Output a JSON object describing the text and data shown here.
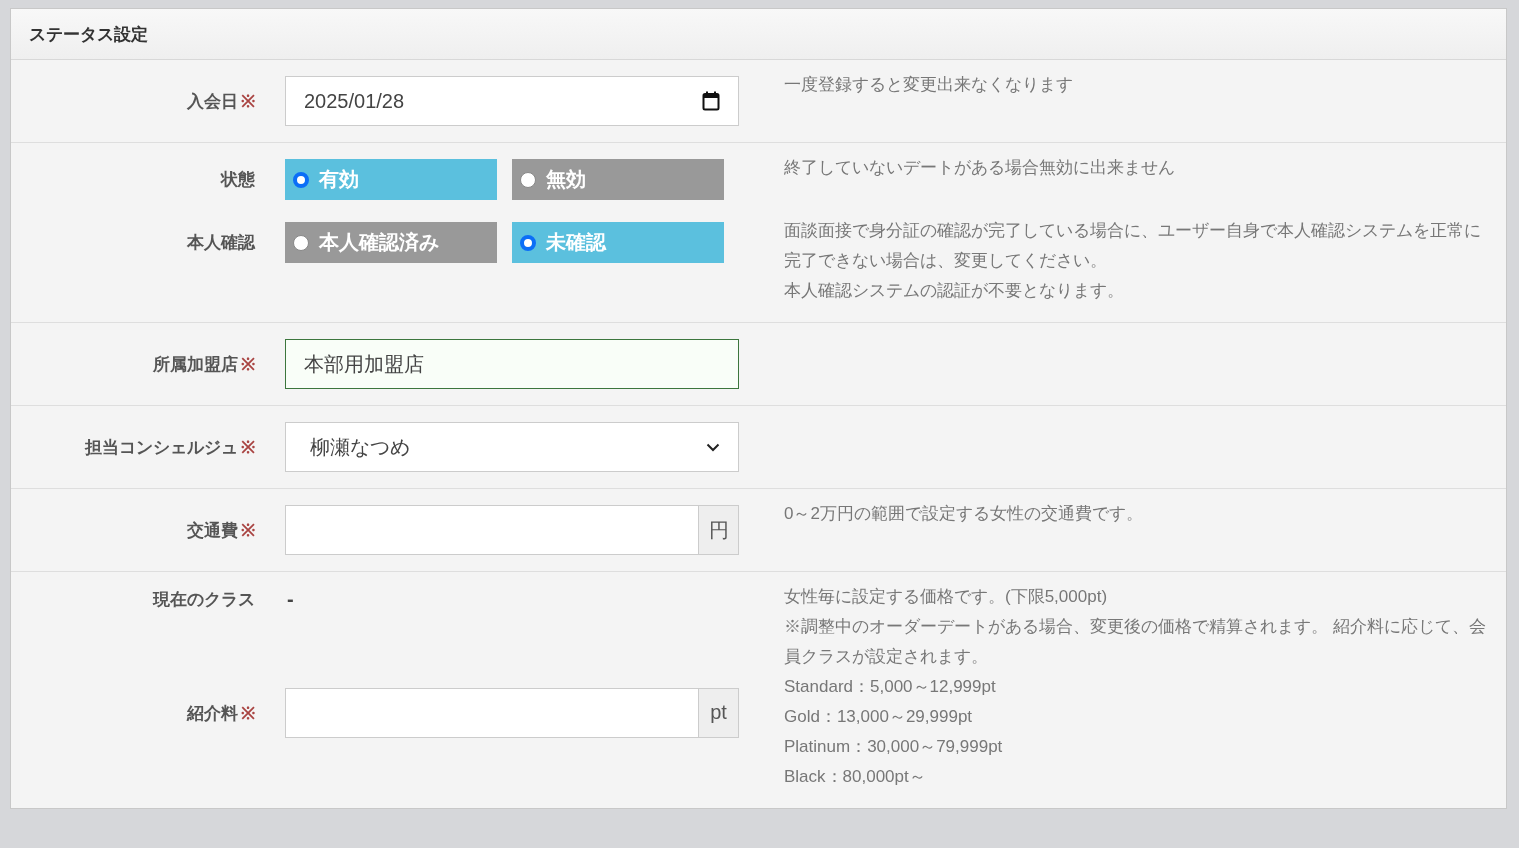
{
  "panel": {
    "title": "ステータス設定"
  },
  "sections": [
    {
      "fields": [
        {
          "kind": "date",
          "label": "入会日",
          "required_mark": "※",
          "value": "2025/01/28",
          "help": [
            "一度登録すると変更出来なくなります"
          ]
        }
      ]
    },
    {
      "fields": [
        {
          "kind": "radio",
          "label": "状態",
          "options": [
            {
              "label": "有効",
              "selected": true
            },
            {
              "label": "無効",
              "selected": false
            }
          ],
          "help": [
            "終了していないデートがある場合無効に出来ません"
          ]
        },
        {
          "kind": "radio",
          "label": "本人確認",
          "options": [
            {
              "label": "本人確認済み",
              "selected": false
            },
            {
              "label": "未確認",
              "selected": true
            }
          ],
          "help": [
            "面談面接で身分証の確認が完了している場合に、ユーザー自身で本人確認システムを正常に完了できない場合は、変更してください。",
            "本人確認システムの認証が不要となります。"
          ]
        }
      ]
    },
    {
      "fields": [
        {
          "kind": "text",
          "label": "所属加盟店",
          "required_mark": "※",
          "value": "本部用加盟店",
          "valid": true
        }
      ]
    },
    {
      "fields": [
        {
          "kind": "select",
          "label": "担当コンシェルジュ",
          "required_mark": "※",
          "value": "柳瀬なつめ"
        }
      ]
    },
    {
      "fields": [
        {
          "kind": "unit",
          "label": "交通費",
          "required_mark": "※",
          "unit": "円",
          "help": [
            "0～2万円の範囲で設定する女性の交通費です。"
          ]
        }
      ]
    },
    {
      "fields": [
        {
          "kind": "static",
          "label": "現在のクラス",
          "value": "-",
          "help": [
            "女性毎に設定する価格です。(下限5,000pt)",
            "※調整中のオーダーデートがある場合、変更後の価格で精算されます。 紹介料に応じて、会員クラスが設定されます。",
            "Standard：5,000～12,999pt",
            "Gold：13,000～29,999pt",
            "Platinum：30,000～79,999pt",
            "Black：80,000pt～"
          ]
        },
        {
          "kind": "unit",
          "label": "紹介料",
          "required_mark": "※",
          "unit": "pt"
        }
      ]
    }
  ]
}
